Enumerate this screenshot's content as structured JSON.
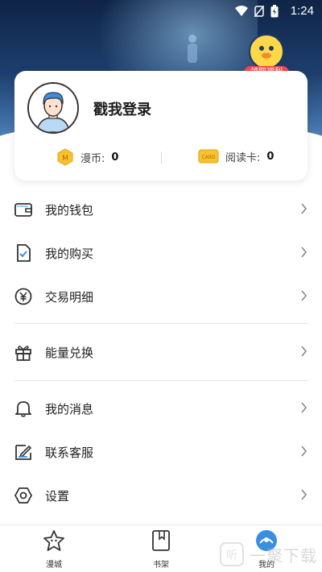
{
  "status_bar": {
    "time": "1:24"
  },
  "mascot": {
    "badge": "领取福利"
  },
  "profile": {
    "login_text": "戳我登录",
    "coin_label": "漫币:",
    "coin_value": "0",
    "card_label": "阅读卡:",
    "card_value": "0",
    "coin_badge": "M",
    "card_badge": "CARD"
  },
  "menu": {
    "group1": [
      {
        "icon": "wallet-icon",
        "label": "我的钱包"
      },
      {
        "icon": "purchase-icon",
        "label": "我的购买"
      },
      {
        "icon": "yen-icon",
        "label": "交易明细"
      }
    ],
    "group2": [
      {
        "icon": "gift-icon",
        "label": "能量兑换"
      }
    ],
    "group3": [
      {
        "icon": "bell-icon",
        "label": "我的消息"
      },
      {
        "icon": "service-icon",
        "label": "联系客服"
      },
      {
        "icon": "settings-icon",
        "label": "设置"
      }
    ]
  },
  "bottom_nav": [
    {
      "icon": "star-home-icon",
      "label": "漫城"
    },
    {
      "icon": "bookshelf-icon",
      "label": "书架"
    },
    {
      "icon": "mine-icon",
      "label": "我的"
    }
  ],
  "watermark": {
    "text": "一聚下载"
  }
}
